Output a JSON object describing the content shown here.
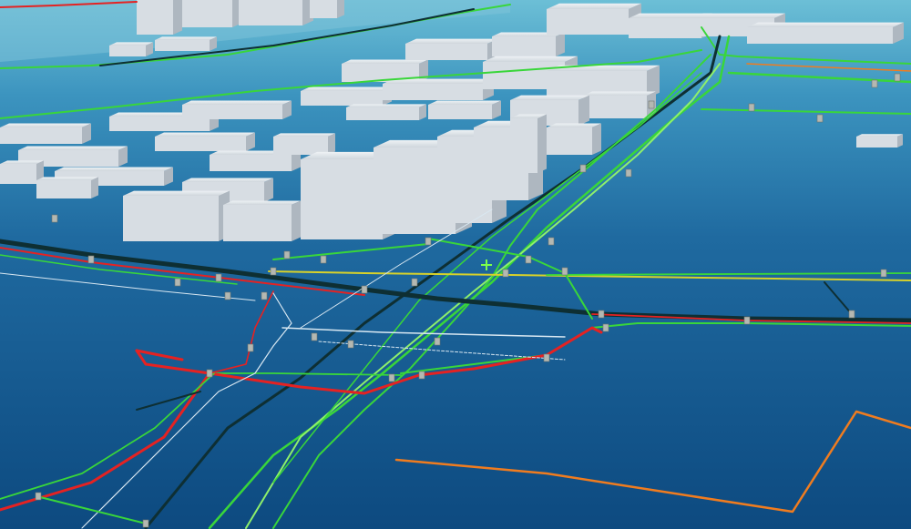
{
  "scene": {
    "kind": "3d-utility-network-map",
    "colors": {
      "water_far": "#4aa3c4",
      "water_near": "#0e4f86",
      "building": "#d7dde3",
      "building_shadow": "#aeb7c0",
      "line_green": "#39d63a",
      "line_lightgreen": "#8ef06b",
      "line_red": "#e52222",
      "line_dark": "#0e2f33",
      "line_yellow": "#d8d22a",
      "line_orange": "#f07c1f",
      "line_white": "#d9e8f2",
      "node": "#b4b8b2"
    },
    "icons": {
      "cursor": "crosshair-icon",
      "node": "pipe-junction-icon"
    }
  }
}
